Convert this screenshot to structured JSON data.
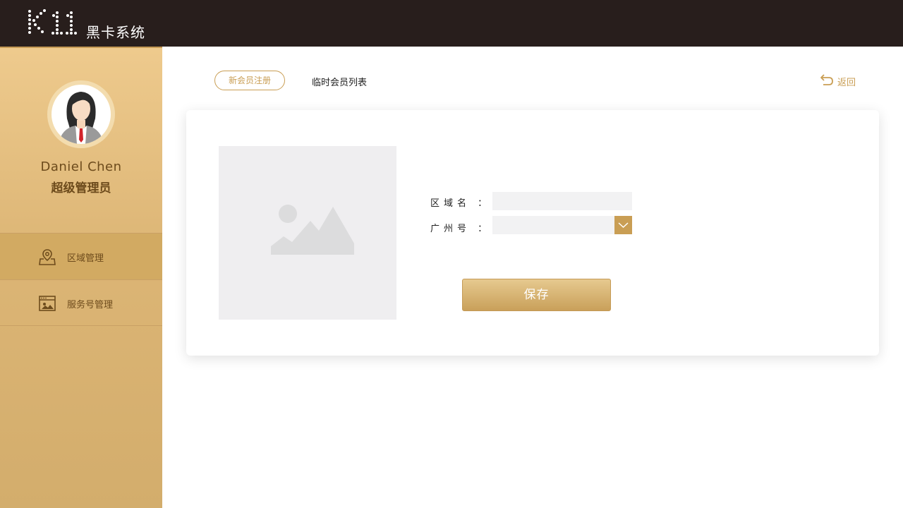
{
  "header": {
    "logo_text": "K11",
    "app_name": "黑卡系统"
  },
  "user": {
    "name": "Daniel Chen",
    "role": "超级管理员"
  },
  "sidebar": {
    "items": [
      {
        "label": "区域管理",
        "icon": "map-pin-icon",
        "active": true
      },
      {
        "label": "服务号管理",
        "icon": "service-window-icon",
        "active": false
      }
    ]
  },
  "tabs": [
    {
      "label": "新会员注册",
      "active": true
    },
    {
      "label": "临时会员列表",
      "active": false
    }
  ],
  "back_label": "返回",
  "form": {
    "area_label": "区域名 ：",
    "area_value": "",
    "city_label": "广州号 ：",
    "city_value": "",
    "save_label": "保存"
  },
  "colors": {
    "accent": "#c99e54",
    "topbar": "#281e1c",
    "sidebar": "#dcb575"
  }
}
